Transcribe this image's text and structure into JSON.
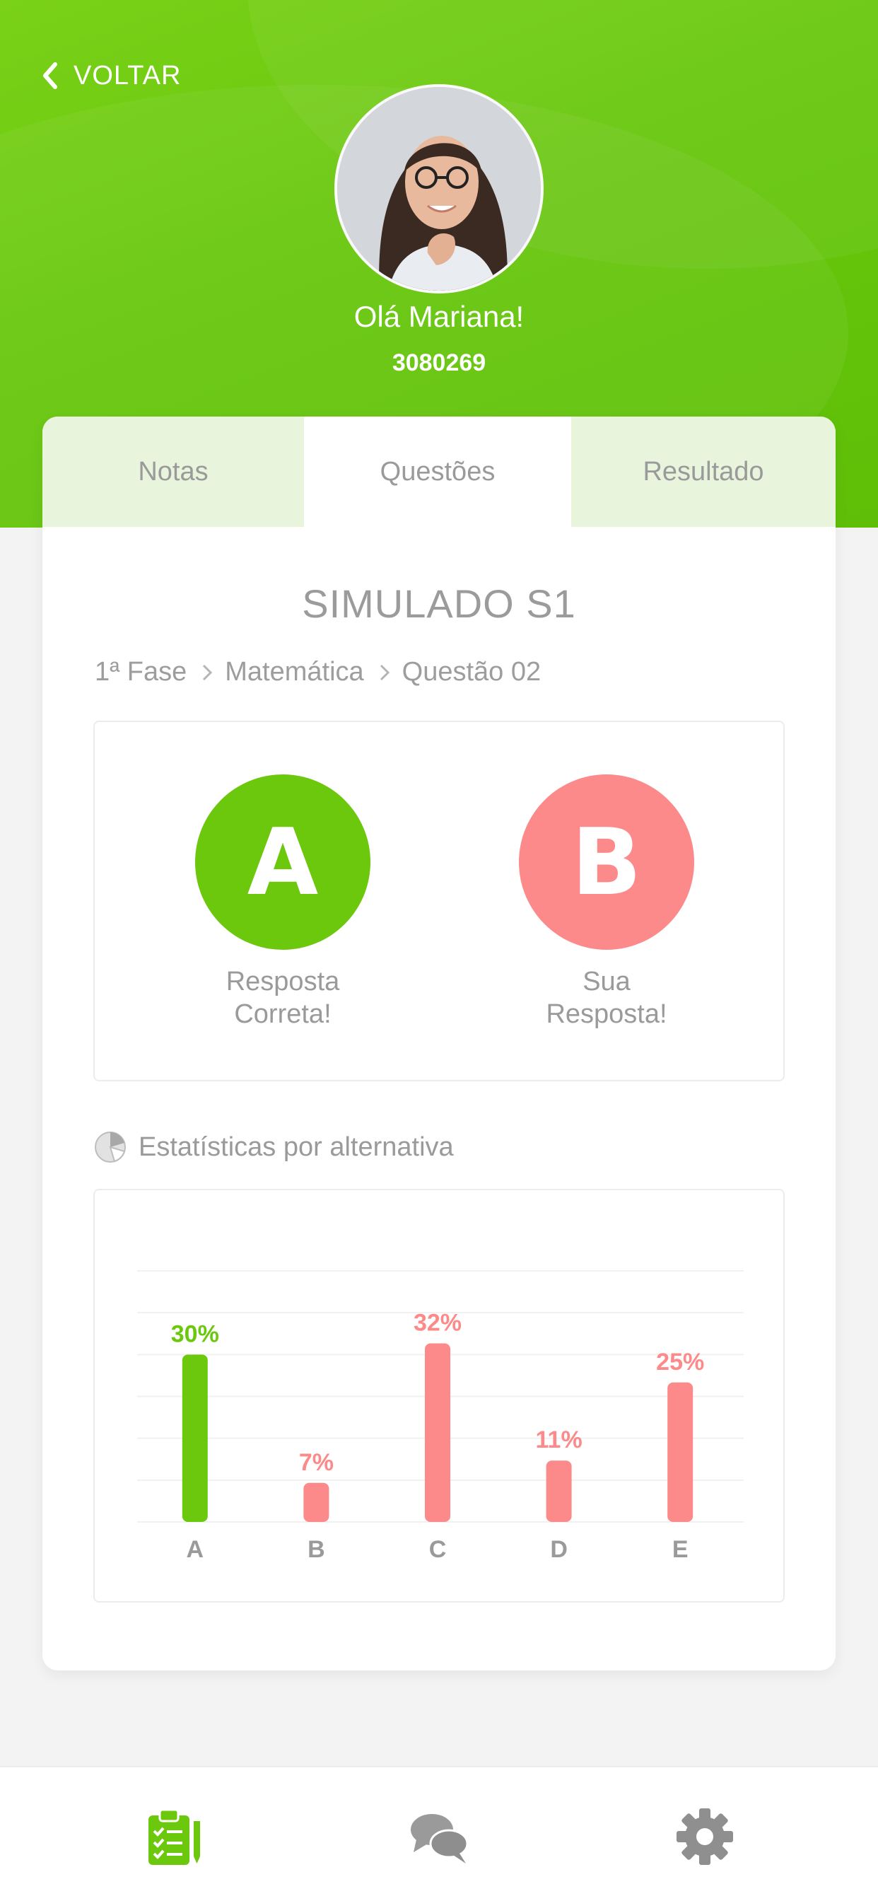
{
  "header": {
    "back_label": "VOLTAR",
    "greeting": "Olá Mariana!",
    "user_id": "3080269"
  },
  "tabs": [
    {
      "label": "Notas"
    },
    {
      "label": "Questões"
    },
    {
      "label": "Resultado"
    }
  ],
  "simulado": {
    "title": "SIMULADO S1",
    "breadcrumb": [
      "1ª Fase",
      "Matemática",
      "Questão 02"
    ]
  },
  "answers": {
    "correct": {
      "letter": "A",
      "line1": "Resposta",
      "line2": "Correta!"
    },
    "user": {
      "letter": "B",
      "line1": "Sua",
      "line2": "Resposta!"
    }
  },
  "stats": {
    "title": "Estatísticas por alternativa"
  },
  "chart_data": {
    "type": "bar",
    "categories": [
      "A",
      "B",
      "C",
      "D",
      "E"
    ],
    "values": [
      30,
      7,
      32,
      11,
      25
    ],
    "labels": [
      "30%",
      "7%",
      "32%",
      "11%",
      "25%"
    ],
    "correct_category": "A",
    "ylim": [
      0,
      45
    ],
    "grid": true,
    "colors": {
      "correct": "#6cc80d",
      "other": "#fd8a8a",
      "axis_label": "#9a9a9a"
    }
  },
  "colors": {
    "brand_green": "#6cc80d",
    "wrong_red": "#fd8a8a",
    "tab_inactive_bg": "#e8f5dc"
  },
  "bottom_nav": [
    {
      "name": "simulados",
      "icon": "clipboard-checklist-icon",
      "active": true
    },
    {
      "name": "chat",
      "icon": "chat-bubbles-icon",
      "active": false
    },
    {
      "name": "settings",
      "icon": "gear-icon",
      "active": false
    }
  ]
}
